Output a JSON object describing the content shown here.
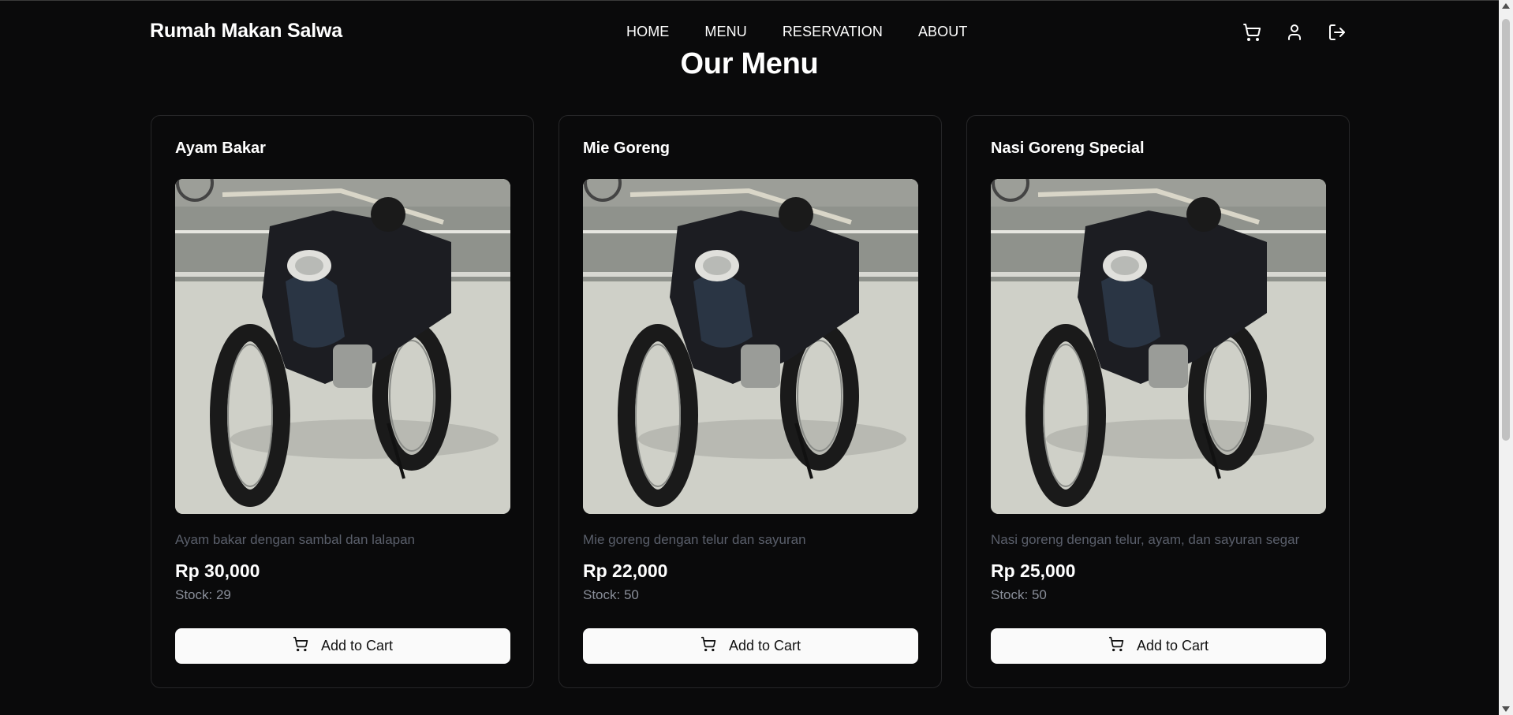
{
  "header": {
    "brand": "Rumah Makan Salwa",
    "nav": [
      "HOME",
      "MENU",
      "RESERVATION",
      "ABOUT"
    ],
    "icons": [
      "cart-icon",
      "user-icon",
      "logout-icon"
    ]
  },
  "page_title": "Our Menu",
  "menu_items": [
    {
      "name": "Ayam Bakar",
      "description": "Ayam bakar dengan sambal dan lalapan",
      "price": "Rp 30,000",
      "stock": "Stock: 29",
      "button": "Add to Cart"
    },
    {
      "name": "Mie Goreng",
      "description": "Mie goreng dengan telur dan sayuran",
      "price": "Rp 22,000",
      "stock": "Stock: 50",
      "button": "Add to Cart"
    },
    {
      "name": "Nasi Goreng Special",
      "description": "Nasi goreng dengan telur, ayam, dan sayuran segar",
      "price": "Rp 25,000",
      "stock": "Stock: 50",
      "button": "Add to Cart"
    }
  ],
  "colors": {
    "background": "#0a0a0b",
    "card_border": "#262628",
    "button_bg": "#fafafa",
    "muted_text": "#5a5f6b"
  }
}
